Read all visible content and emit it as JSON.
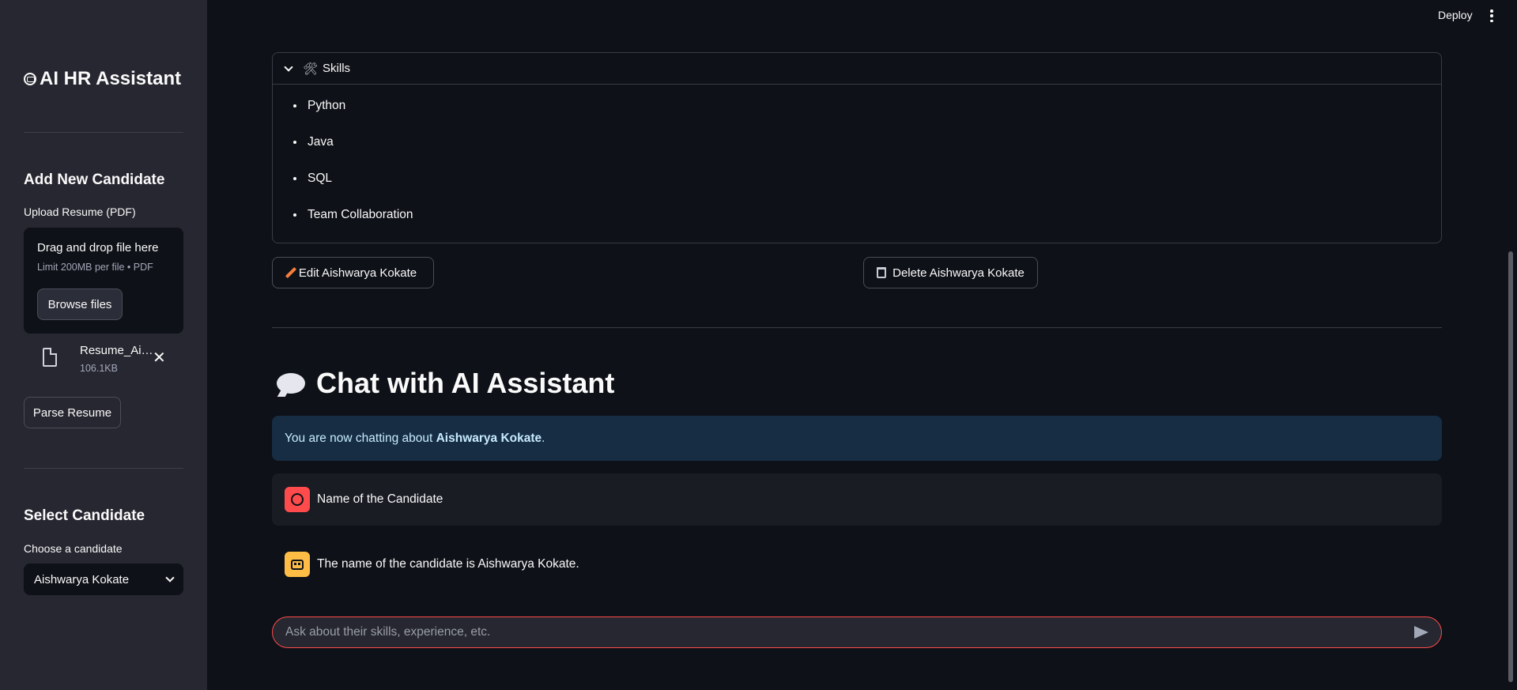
{
  "header": {
    "deploy_label": "Deploy"
  },
  "sidebar": {
    "app_title": "AI HR Assistant",
    "add_heading": "Add New Candidate",
    "upload_label": "Upload Resume (PDF)",
    "dropzone_title": "Drag and drop file here",
    "dropzone_limit": "Limit 200MB per file • PDF",
    "browse_label": "Browse files",
    "file_name": "Resume_Aishwarya_Kokate.pdf",
    "file_size": "106.1KB",
    "parse_label": "Parse Resume",
    "select_heading": "Select Candidate",
    "choose_label": "Choose a candidate",
    "selected_candidate": "Aishwarya Kokate"
  },
  "skills": {
    "title": "Skills",
    "items": [
      "Python",
      "Java",
      "SQL",
      "Team Collaboration"
    ]
  },
  "actions": {
    "edit_label": "Edit Aishwarya Kokate",
    "delete_label": "Delete Aishwarya Kokate"
  },
  "chat": {
    "title": "Chat with AI Assistant",
    "info_prefix": "You are now chatting about ",
    "info_name": "Aishwarya Kokate",
    "info_suffix": ".",
    "messages": [
      {
        "role": "user",
        "text": "Name of the Candidate"
      },
      {
        "role": "assistant",
        "text": "The name of the candidate is Aishwarya Kokate."
      }
    ],
    "input_placeholder": "Ask about their skills, experience, etc."
  }
}
